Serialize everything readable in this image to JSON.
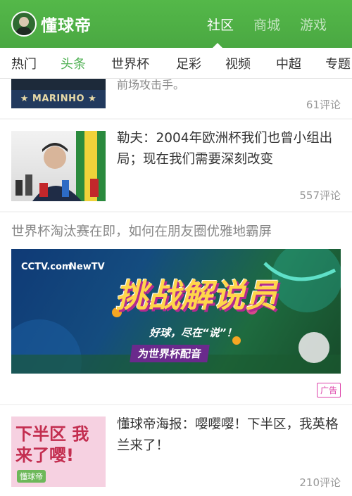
{
  "app": {
    "title": "懂球帝"
  },
  "top_tabs": [
    {
      "label": "社区",
      "active": true
    },
    {
      "label": "商城",
      "active": false
    },
    {
      "label": "游戏",
      "active": false
    }
  ],
  "sub_nav": [
    {
      "label": "热门",
      "active": false
    },
    {
      "label": "头条",
      "active": true
    },
    {
      "label": "世界杯",
      "active": false
    },
    {
      "label": "足彩",
      "active": false
    },
    {
      "label": "视频",
      "active": false
    },
    {
      "label": "中超",
      "active": false
    },
    {
      "label": "专题",
      "active": false
    }
  ],
  "feed": [
    {
      "title": "前场攻击手。",
      "comments": "61评论",
      "thumb_caption": "★ MARINHO ★"
    },
    {
      "title": "勒夫：2004年欧洲杯我们也曾小组出局；现在我们需要深刻改变",
      "comments": "557评论"
    },
    {
      "title": "世界杯淘汰赛在即，如何在朋友圈优雅地霸屏",
      "badge": "广告",
      "banner": {
        "logo1": "CCTV.com",
        "logo2": "NewTV",
        "headline": "挑战解说员",
        "sub": "好球，尽在“说”！",
        "ribbon": "为世界杯配音"
      }
    },
    {
      "title": "懂球帝海报：嘤嘤嘤！下半区，我英格兰来了！",
      "comments": "210评论",
      "poster_text": "下半区 我来了嘤!",
      "poster_logo": "懂球帝"
    }
  ],
  "colors": {
    "brand": "#4caf50",
    "ad_badge": "#dd44aa"
  }
}
